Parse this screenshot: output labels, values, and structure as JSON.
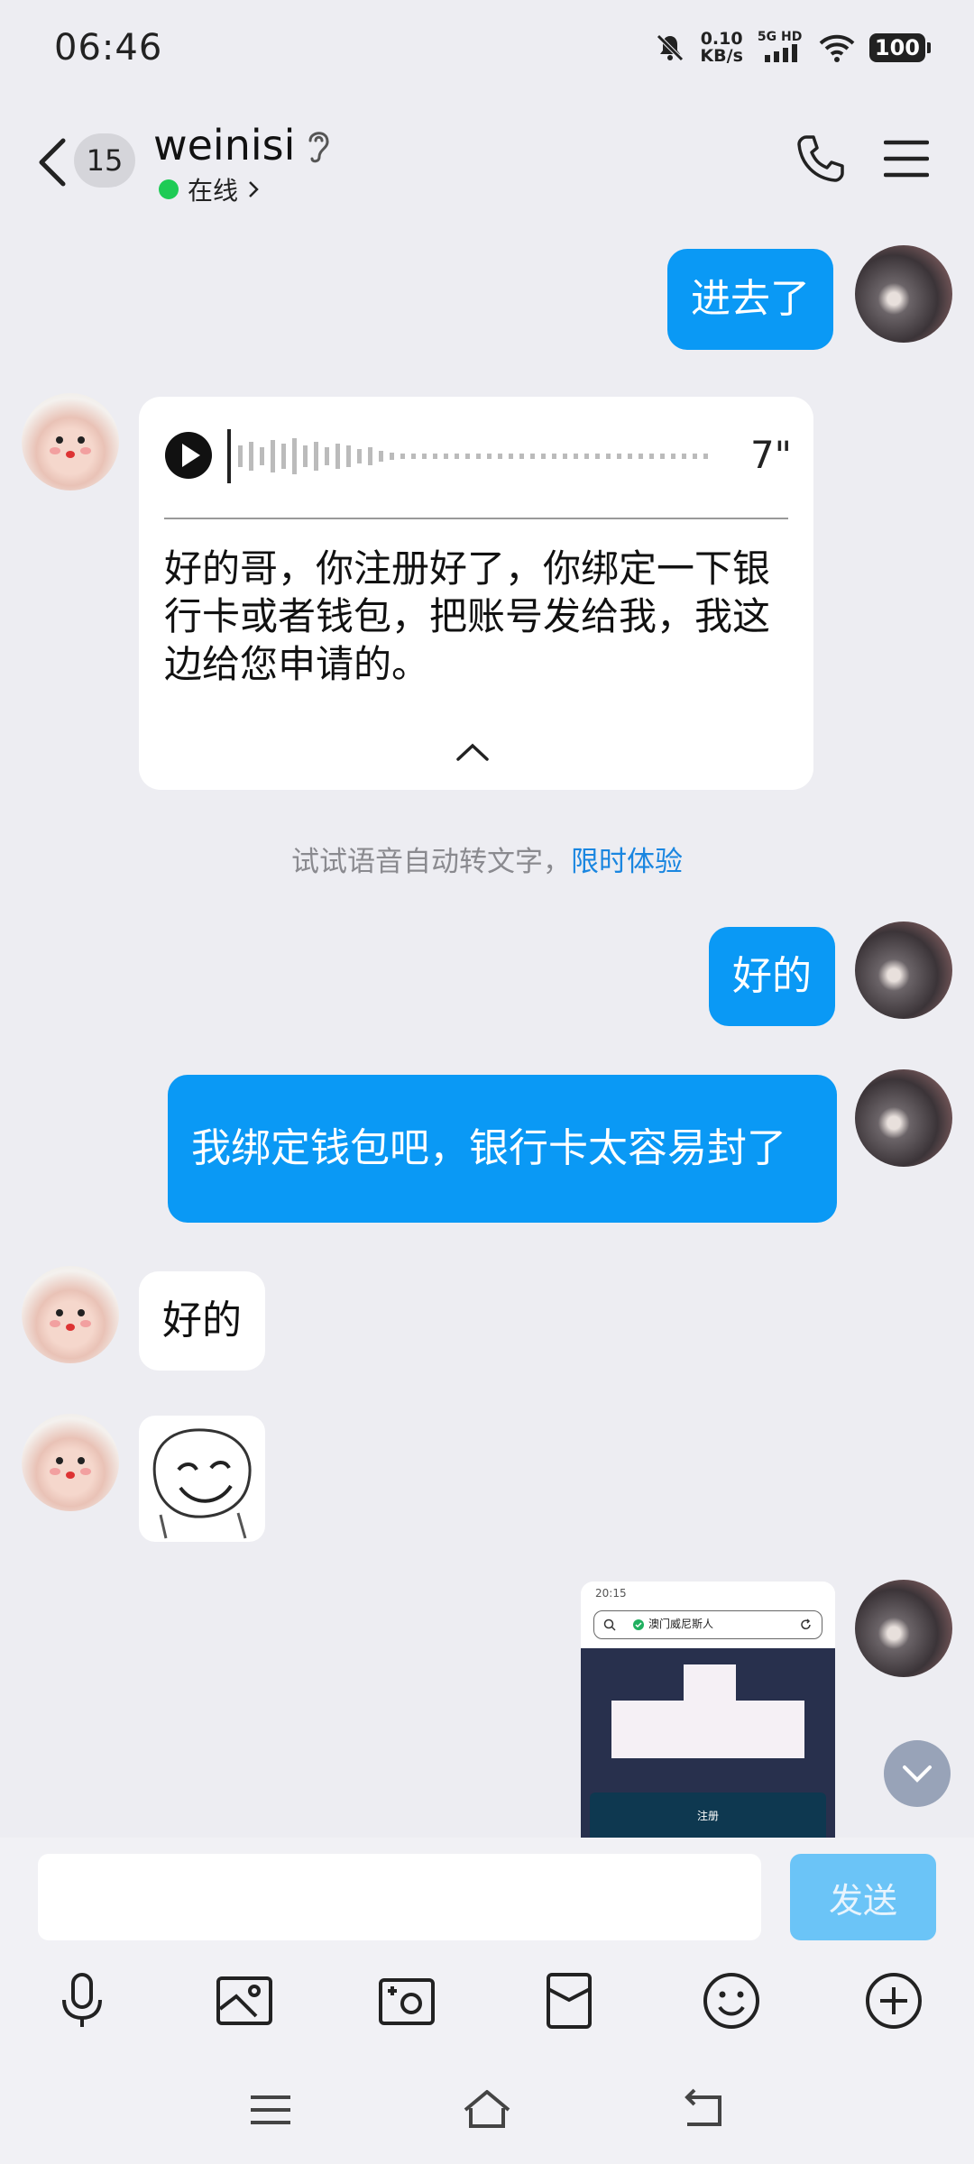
{
  "status_bar": {
    "time": "06:46",
    "net_speed_value": "0.10",
    "net_speed_unit": "KB/s",
    "network": "5G HD",
    "battery": "100",
    "icons": [
      "mute-icon",
      "signal-icon",
      "wifi-icon",
      "battery-icon"
    ]
  },
  "header": {
    "unread_count": "15",
    "contact_name": "weinisi",
    "status": "在线",
    "icons": [
      "back-icon",
      "ear-icon",
      "phone-icon",
      "menu-icon"
    ]
  },
  "messages": [
    {
      "side": "out",
      "type": "text",
      "text": "进去了"
    },
    {
      "side": "in",
      "type": "voice",
      "duration": "7\"",
      "transcript": "好的哥，你注册好了，你绑定一下银行卡或者钱包，把账号发给我，我这边给您申请的。"
    },
    {
      "side": "system",
      "type": "hint",
      "text": "试试语音自动转文字，",
      "link": "限时体验"
    },
    {
      "side": "out",
      "type": "text",
      "text": "好的"
    },
    {
      "side": "out",
      "type": "text",
      "text": "我绑定钱包吧，银行卡太容易封了"
    },
    {
      "side": "in",
      "type": "text",
      "text": "好的"
    },
    {
      "side": "in",
      "type": "sticker",
      "icon": "smile-sticker-icon"
    },
    {
      "side": "out",
      "type": "image",
      "image": {
        "time": "20:15",
        "url_text": "澳门威尼斯人",
        "button_text": "注册"
      }
    }
  ],
  "composer": {
    "input_value": "",
    "send_label": "发送"
  },
  "toolbar": [
    "mic-icon",
    "image-icon",
    "camera-icon",
    "red-packet-icon",
    "emoji-icon",
    "plus-icon"
  ],
  "navbar": [
    "nav-menu-icon",
    "nav-home-icon",
    "nav-back-icon"
  ],
  "colors": {
    "background": "#ededf2",
    "outgoing_bubble": "#0a99f5",
    "incoming_bubble": "#ffffff",
    "link": "#1a86e0",
    "online": "#1ecb55",
    "send_button": "#6bc4f7"
  }
}
